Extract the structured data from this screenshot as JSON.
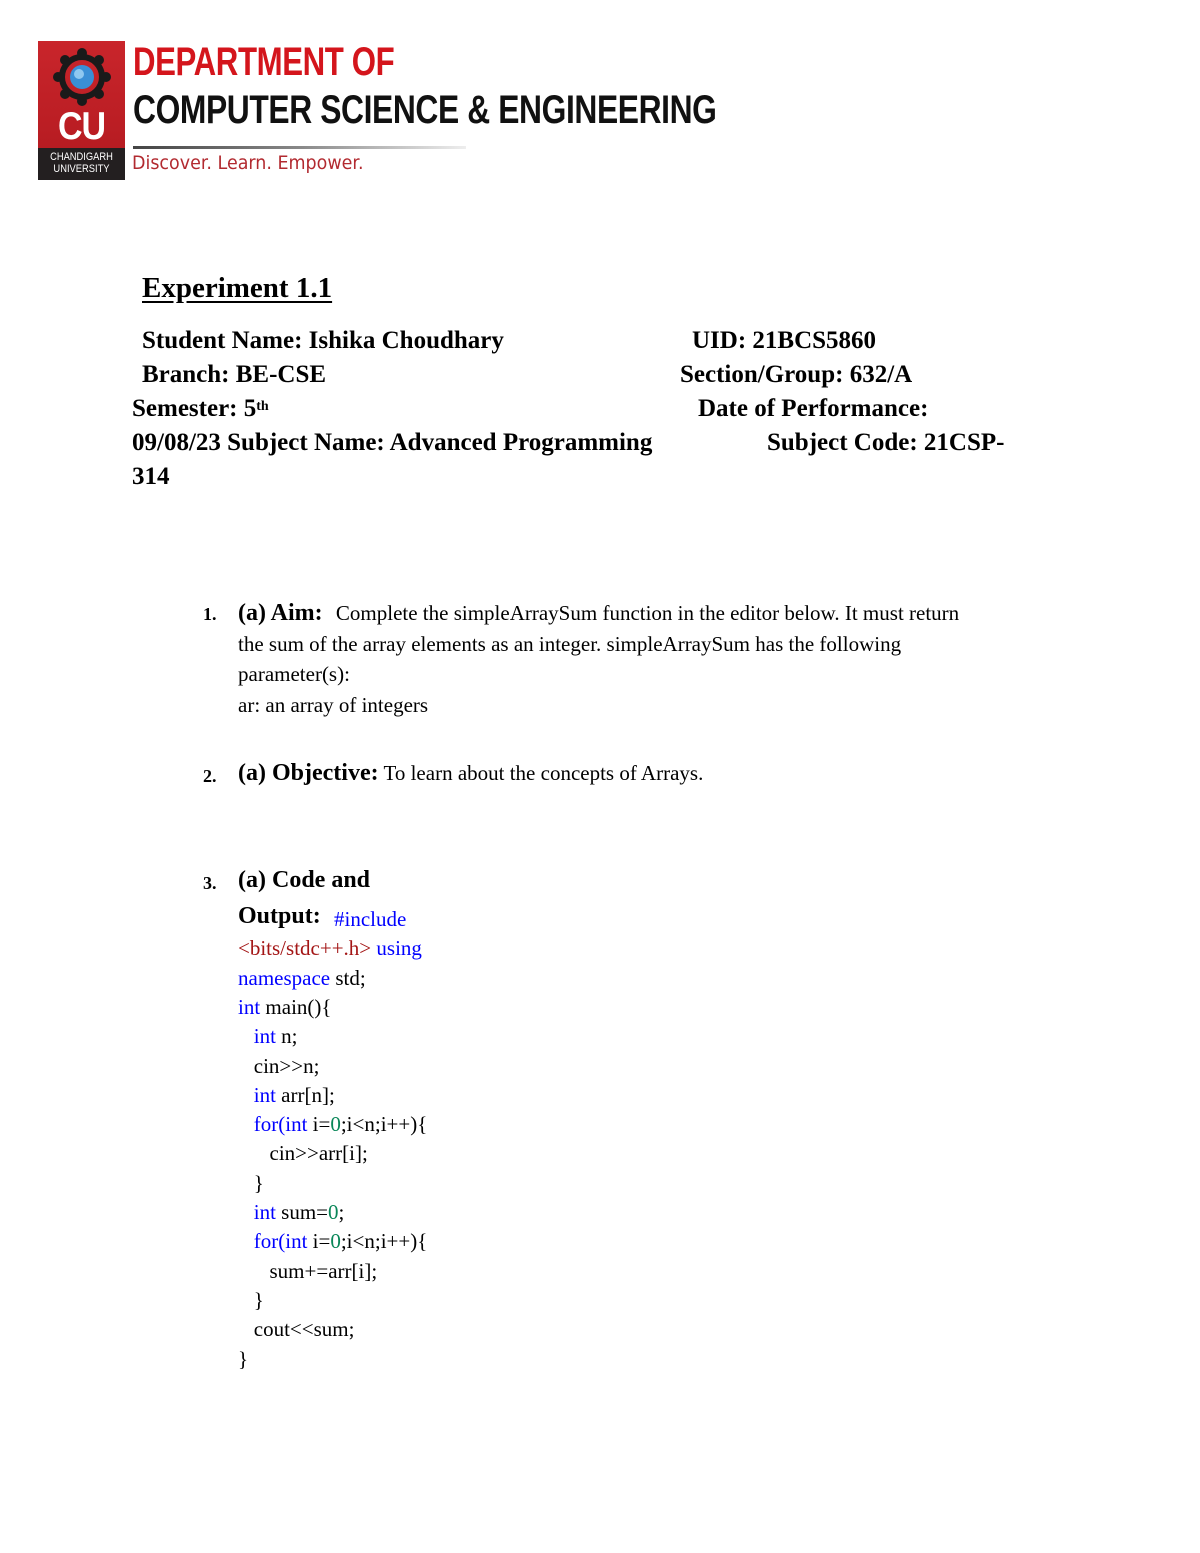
{
  "header": {
    "logo": {
      "monogram": "CU",
      "university_line1": "CHANDIGARH",
      "university_line2": "UNIVERSITY"
    },
    "department_line1": "DEPARTMENT OF",
    "department_line2": "COMPUTER SCIENCE & ENGINEERING",
    "tagline": "Discover. Learn. Empower.",
    "colors": {
      "brand_red": "#d4151c",
      "logo_red": "#c9252b",
      "tagline_red": "#b22a30"
    }
  },
  "experiment": {
    "title": "Experiment 1.1",
    "student_name": "Student Name: Ishika Choudhary",
    "uid": "UID: 21BCS5860",
    "branch": "Branch: BE-CSE",
    "section": "Section/Group: 632/A",
    "semester_label": "Semester: 5",
    "semester_suffix": "th",
    "date_label": "Date of Performance:",
    "date_and_subject": "09/08/23 Subject Name: Advanced Programming",
    "subject_code": "Subject Code: 21CSP-",
    "subject_code_cont": "314"
  },
  "sections": [
    {
      "number": "1.",
      "label": "(a) Aim:",
      "text_line1": "Complete the simpleArraySum function in the editor below. It must return",
      "text_line2": "the sum of the array elements as an integer. simpleArraySum has the following",
      "text_line3": "parameter(s):",
      "text_line4": "ar: an array of integers"
    },
    {
      "number": "2.",
      "label": "(a) Objective:",
      "text": "To learn about the concepts of Arrays."
    },
    {
      "number": "3.",
      "label_line1": "(a) Code and",
      "label_line2": "Output:"
    }
  ],
  "code": {
    "colors": {
      "keyword": "#0000ff",
      "string": "#a31515",
      "number": "#098658"
    },
    "lines": [
      {
        "tokens": [
          {
            "t": "#include",
            "c": "kw"
          }
        ]
      },
      {
        "tokens": [
          {
            "t": "<bits/stdc++.h>",
            "c": "str"
          },
          {
            "t": " using",
            "c": "kw"
          }
        ]
      },
      {
        "tokens": [
          {
            "t": "namespace",
            "c": "kw"
          },
          {
            "t": " std;",
            "c": ""
          }
        ]
      },
      {
        "tokens": [
          {
            "t": "int",
            "c": "kw"
          },
          {
            "t": " main(){",
            "c": ""
          }
        ]
      },
      {
        "tokens": [
          {
            "t": "   ",
            "c": ""
          },
          {
            "t": "int",
            "c": "kw"
          },
          {
            "t": " n;",
            "c": ""
          }
        ]
      },
      {
        "tokens": [
          {
            "t": "   cin>>n;",
            "c": ""
          }
        ]
      },
      {
        "tokens": [
          {
            "t": "   ",
            "c": ""
          },
          {
            "t": "int",
            "c": "kw"
          },
          {
            "t": " arr[n];",
            "c": ""
          }
        ]
      },
      {
        "tokens": [
          {
            "t": "   ",
            "c": ""
          },
          {
            "t": "for(",
            "c": "kw"
          },
          {
            "t": "int",
            "c": "kw"
          },
          {
            "t": " i=",
            "c": ""
          },
          {
            "t": "0",
            "c": "num-lit"
          },
          {
            "t": ";i<n;i++){",
            "c": ""
          }
        ]
      },
      {
        "tokens": [
          {
            "t": "      cin>>arr[i];",
            "c": ""
          }
        ]
      },
      {
        "tokens": [
          {
            "t": "   }",
            "c": ""
          }
        ]
      },
      {
        "tokens": [
          {
            "t": "   ",
            "c": ""
          },
          {
            "t": "int",
            "c": "kw"
          },
          {
            "t": " sum=",
            "c": ""
          },
          {
            "t": "0",
            "c": "num-lit"
          },
          {
            "t": ";",
            "c": ""
          }
        ]
      },
      {
        "tokens": [
          {
            "t": "   ",
            "c": ""
          },
          {
            "t": "for(",
            "c": "kw"
          },
          {
            "t": "int",
            "c": "kw"
          },
          {
            "t": " i=",
            "c": ""
          },
          {
            "t": "0",
            "c": "num-lit"
          },
          {
            "t": ";i<n;i++){",
            "c": ""
          }
        ]
      },
      {
        "tokens": [
          {
            "t": "      sum+=arr[i];",
            "c": ""
          }
        ]
      },
      {
        "tokens": [
          {
            "t": "   }",
            "c": ""
          }
        ]
      },
      {
        "tokens": [
          {
            "t": "   cout<<sum;",
            "c": ""
          }
        ]
      },
      {
        "tokens": [
          {
            "t": "}",
            "c": ""
          }
        ]
      }
    ]
  }
}
